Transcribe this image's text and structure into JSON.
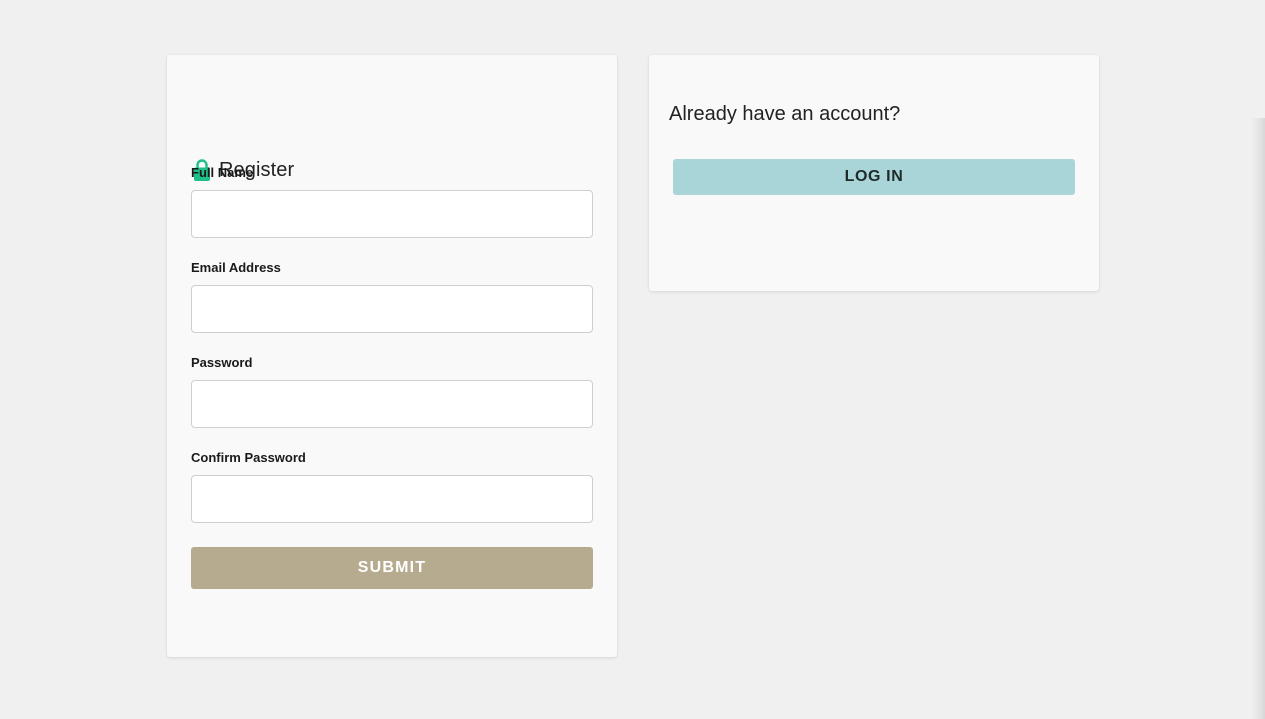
{
  "register": {
    "title": "Register",
    "icon": "lock-icon",
    "icon_color": "#1fbf8a",
    "fields": [
      {
        "label": "Full Name",
        "value": "",
        "placeholder": ""
      },
      {
        "label": "Email Address",
        "value": "",
        "placeholder": ""
      },
      {
        "label": "Password",
        "value": "",
        "placeholder": ""
      },
      {
        "label": "Confirm Password",
        "value": "",
        "placeholder": ""
      }
    ],
    "submit_label": "SUBMIT",
    "submit_color": "#b7ab8f"
  },
  "login": {
    "heading": "Already have an account?",
    "button_label": "LOG IN",
    "button_color": "#a9d5d8"
  },
  "colors": {
    "background": "#f0f0f0",
    "card": "#f9f9f9"
  }
}
